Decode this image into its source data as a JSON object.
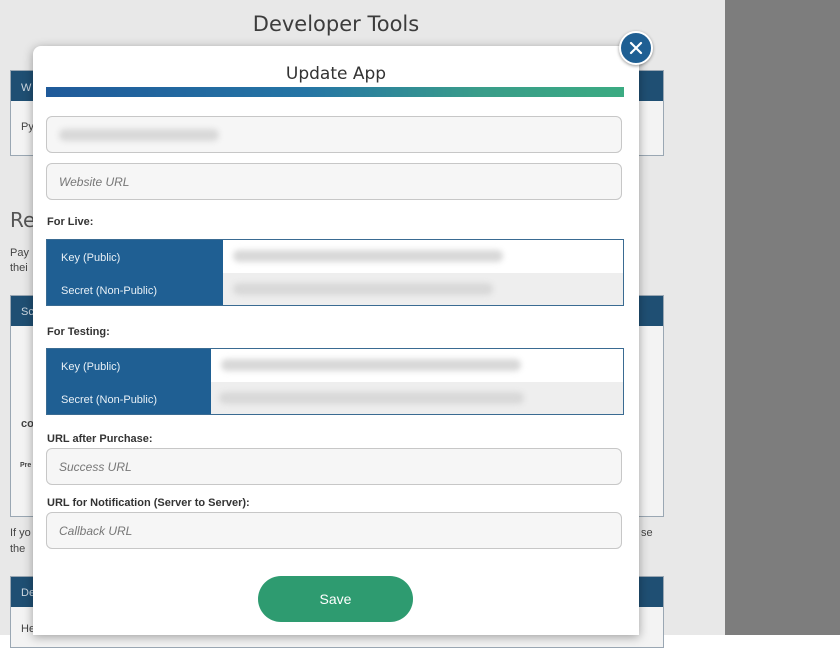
{
  "background": {
    "page_title": "Developer Tools",
    "fragments": {
      "w": "W",
      "py": "Py",
      "re": "Re",
      "pay": "Pay",
      "thei": "thei",
      "sc": "Sc",
      "co": "co",
      "pre": "Pre",
      "if_yo": "If yo",
      "the": "the",
      "se": "se",
      "de": "De",
      "he": "He"
    }
  },
  "modal": {
    "title": "Update App",
    "app_name_value": "",
    "website_url_placeholder": "Website URL",
    "for_live_label": "For Live:",
    "live": {
      "key_label": "Key (Public)",
      "secret_label": "Secret (Non-Public)"
    },
    "for_testing_label": "For Testing:",
    "testing": {
      "key_label": "Key (Public)",
      "secret_label": "Secret (Non-Public)"
    },
    "url_after_purchase_label": "URL after Purchase:",
    "success_url_placeholder": "Success URL",
    "url_notification_label": "URL for Notification (Server to Server):",
    "callback_url_placeholder": "Callback URL",
    "save_label": "Save"
  },
  "colors": {
    "primary_blue": "#1f5f93",
    "save_green": "#2e9b70",
    "gradient_start": "#1f5a9a",
    "gradient_end": "#3bab82"
  },
  "icons": {
    "close": "close-icon"
  }
}
